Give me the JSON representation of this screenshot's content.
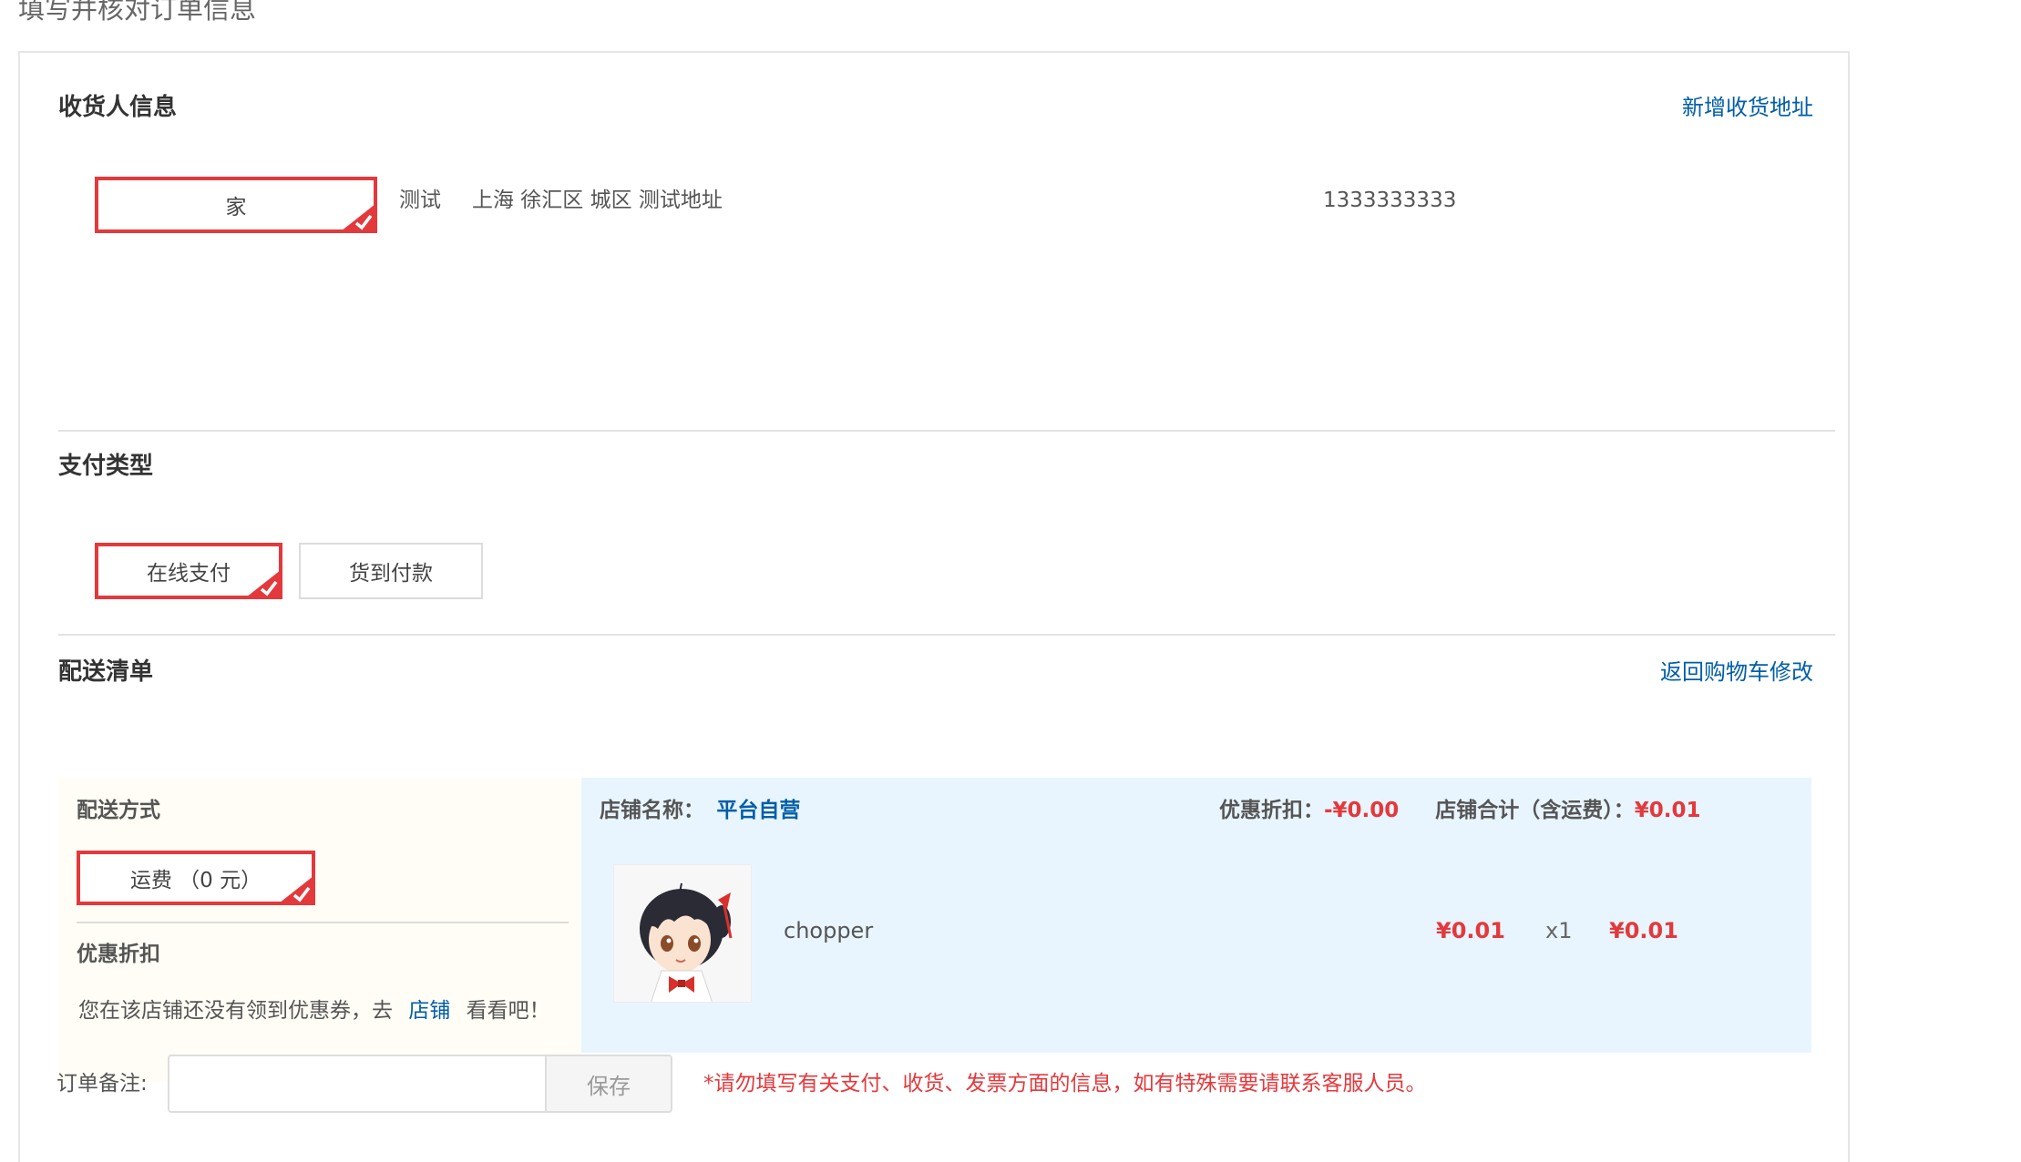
{
  "page_title": "填写并核对订单信息",
  "consignee": {
    "title": "收货人信息",
    "add_link": "新增收货地址",
    "tag": "家",
    "name": "测试",
    "address": "上海 徐汇区 城区 测试地址",
    "phone": "1333333333"
  },
  "payment": {
    "title": "支付类型",
    "options": [
      "在线支付",
      "货到付款"
    ],
    "selected": "在线支付"
  },
  "delivery": {
    "title": "配送清单",
    "back_link": "返回购物车修改",
    "method_label": "配送方式",
    "shipping_option": "运费 （0 元）",
    "discount_label": "优惠折扣",
    "coupon_text_before": "您在该店铺还没有领到优惠券，去",
    "coupon_link": "店铺",
    "coupon_text_after": "看看吧！",
    "shop_name_label": "店铺名称：",
    "shop_name": "平台自营",
    "discount_total_label": "优惠折扣：",
    "discount_total": "-¥0.00",
    "shop_total_label": "店铺合计（含运费）：",
    "shop_total": "¥0.01",
    "item": {
      "name": "chopper",
      "unit_price": "¥0.01",
      "quantity": "x1",
      "subtotal": "¥0.01"
    }
  },
  "remark": {
    "label": "订单备注:",
    "value": "",
    "save_label": "保存",
    "notice": "*请勿填写有关支付、收货、发票方面的信息，如有特殊需要请联系客服人员。"
  },
  "colors": {
    "accent_red": "#e4393c",
    "link_blue": "#005ea7",
    "shop_bg": "#e9f5fe",
    "ship_bg": "#fffdf5"
  },
  "icons": [
    "check-corner-icon",
    "product-thumbnail"
  ]
}
